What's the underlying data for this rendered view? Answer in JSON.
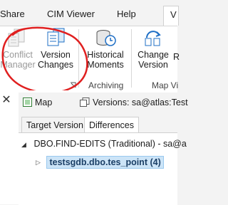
{
  "menu": {
    "share": "Share",
    "cim_viewer": "CIM Viewer",
    "help": "Help",
    "active_tab": "V"
  },
  "ribbon": {
    "conflict_manager": [
      "Conflict",
      "Manager"
    ],
    "version_changes": [
      "Version",
      "Changes"
    ],
    "historical_moments": [
      "Historical",
      "Moments"
    ],
    "change_version": [
      "Change",
      "Version"
    ],
    "r_partial": "R",
    "archiving_label": "Archiving",
    "map_view_label": "Map Vi"
  },
  "panel": {
    "map_tab": "Map",
    "versions_tab": "Versions: sa@atlas:Test",
    "subtab_target": "Target Version",
    "subtab_differences": "Differences",
    "tree_root": "DBO.FIND-EDITS (Traditional) - sa@a",
    "tree_child": "testsgdb.dbo.tes_point (4)"
  },
  "colors": {
    "annotation_red": "#e02020",
    "selection_bg": "#cce4f7",
    "accent_blue": "#1f6fc5"
  }
}
